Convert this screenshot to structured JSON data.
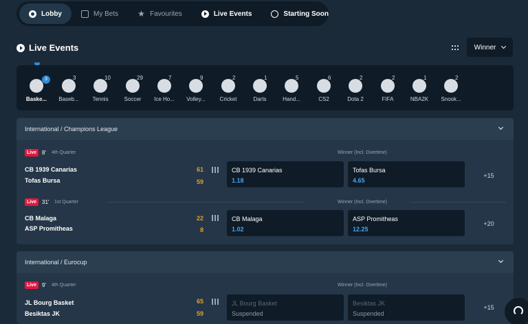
{
  "nav": {
    "items": [
      {
        "label": "Lobby",
        "icon": "lobby-icon"
      },
      {
        "label": "My Bets",
        "icon": "receipt-icon"
      },
      {
        "label": "Favourites",
        "icon": "star-icon"
      },
      {
        "label": "Live Events",
        "icon": "play-icon"
      },
      {
        "label": "Starting Soon",
        "icon": "stopwatch-icon"
      }
    ]
  },
  "header": {
    "title": "Live Events",
    "market_dropdown": "Winner"
  },
  "sports": [
    {
      "label": "Basketball",
      "short": "Baske...",
      "count": "3"
    },
    {
      "label": "Baseball",
      "short": "Baseb...",
      "count": "3"
    },
    {
      "label": "Tennis",
      "short": "Tennis",
      "count": "10"
    },
    {
      "label": "Soccer",
      "short": "Soccer",
      "count": "29"
    },
    {
      "label": "Ice Hockey",
      "short": "Ice Ho...",
      "count": "7"
    },
    {
      "label": "Volleyball",
      "short": "Volley...",
      "count": "9"
    },
    {
      "label": "Cricket",
      "short": "Cricket",
      "count": "2"
    },
    {
      "label": "Darts",
      "short": "Darts",
      "count": "1"
    },
    {
      "label": "Handball",
      "short": "Hand...",
      "count": "5"
    },
    {
      "label": "CS2",
      "short": "CS2",
      "count": "6"
    },
    {
      "label": "Dota 2",
      "short": "Dota 2",
      "count": "2"
    },
    {
      "label": "FIFA",
      "short": "FIFA",
      "count": "2"
    },
    {
      "label": "NBA2K",
      "short": "NBA2K",
      "count": "1"
    },
    {
      "label": "Snooker",
      "short": "Snook...",
      "count": "2"
    }
  ],
  "leagues": [
    {
      "name": "International / Champions League",
      "matches": [
        {
          "live": "Live",
          "minute": "8'",
          "period": "4th Quarter",
          "market": "Winner (Incl. Overtime)",
          "home": "CB 1939 Canarias",
          "away": "Tofas Bursa",
          "home_score": "61",
          "away_score": "59",
          "odds": [
            {
              "name": "CB 1939 Canarias",
              "value": "1.18"
            },
            {
              "name": "Tofas Bursa",
              "value": "4.65"
            }
          ],
          "more": "+15"
        },
        {
          "live": "Live",
          "minute": "31'",
          "period": "1st Quarter",
          "market": "Winner (Incl. Overtime)",
          "home": "CB Malaga",
          "away": "ASP Promitheas",
          "home_score": "22",
          "away_score": "8",
          "odds": [
            {
              "name": "CB Malaga",
              "value": "1.02"
            },
            {
              "name": "ASP Promitheas",
              "value": "12.25"
            }
          ],
          "more": "+20"
        }
      ]
    },
    {
      "name": "International / Eurocup",
      "matches": [
        {
          "live": "Live",
          "minute": "9'",
          "period": "4th Quarter",
          "market": "Winner (Incl. Overtime)",
          "home": "JL Bourg Basket",
          "away": "Besiktas JK",
          "home_score": "65",
          "away_score": "59",
          "odds": [
            {
              "name": "JL Bourg Basket",
              "value": "Suspended"
            },
            {
              "name": "Besiktas JK",
              "value": "Suspended"
            }
          ],
          "more": "+15"
        }
      ]
    }
  ]
}
